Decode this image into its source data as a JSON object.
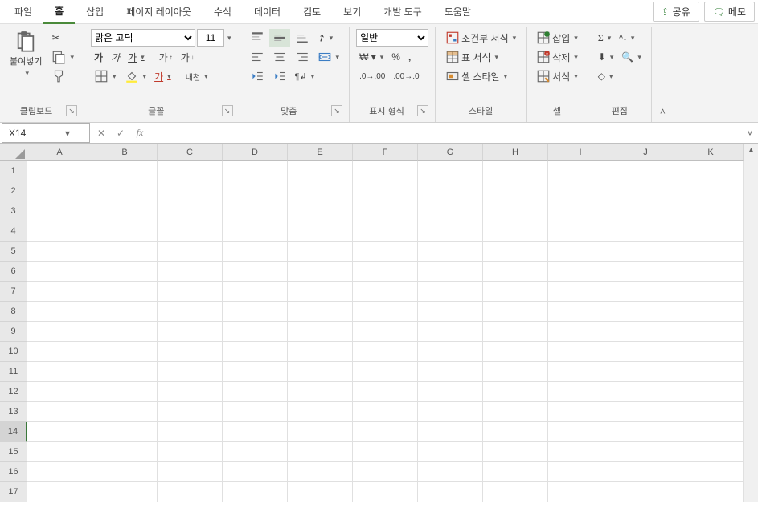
{
  "menu": {
    "tabs": [
      "파일",
      "홈",
      "삽입",
      "페이지 레이아웃",
      "수식",
      "데이터",
      "검토",
      "보기",
      "개발 도구",
      "도움말"
    ],
    "active_index": 1,
    "share": "공유",
    "memo": "메모"
  },
  "ribbon": {
    "clipboard": {
      "label": "클립보드",
      "paste": "붙여넣기"
    },
    "font": {
      "label": "글꼴",
      "name": "맑은 고딕",
      "size": "11",
      "bold": "가",
      "italic": "가",
      "underline": "가",
      "grow": "가",
      "shrink": "가",
      "hanja": "내천"
    },
    "alignment": {
      "label": "맞춤"
    },
    "number": {
      "label": "표시 형식",
      "format": "일반"
    },
    "styles": {
      "label": "스타일",
      "cond": "조건부 서식",
      "table": "표 서식",
      "cell": "셀 스타일"
    },
    "cells": {
      "label": "셀",
      "insert": "삽입",
      "delete": "삭제",
      "format": "서식"
    },
    "editing": {
      "label": "편집"
    }
  },
  "fbar": {
    "name": "X14",
    "fx": "fx",
    "formula": ""
  },
  "grid": {
    "columns": [
      "A",
      "B",
      "C",
      "D",
      "E",
      "F",
      "G",
      "H",
      "I",
      "J",
      "K"
    ],
    "rows": [
      "1",
      "2",
      "3",
      "4",
      "5",
      "6",
      "7",
      "8",
      "9",
      "10",
      "11",
      "12",
      "13",
      "14",
      "15",
      "16",
      "17"
    ],
    "active_row": "14"
  }
}
